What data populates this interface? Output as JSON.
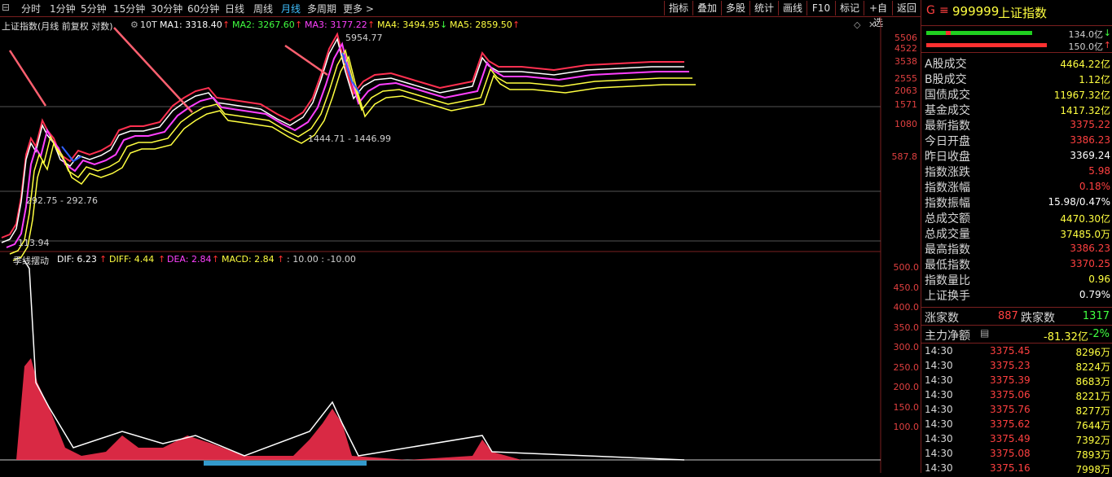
{
  "toolbar": {
    "left_items": [
      "分时",
      "1分钟",
      "5分钟",
      "15分钟",
      "30分钟",
      "60分钟",
      "日线",
      "周线",
      "月线",
      "多周期",
      "更多 >"
    ],
    "active": "月线",
    "right_items": [
      "指标",
      "叠加",
      "多股",
      "统计",
      "画线",
      "F10",
      "标记",
      "+自选",
      "返回"
    ]
  },
  "main_legend": {
    "title": "上证指数(月线 前复权 对数)",
    "period": "10T",
    "ma1": "MA1: 3318.40",
    "ma2": "MA2: 3267.60",
    "ma3": "MA3: 3177.22",
    "ma4": "MA4: 3494.95",
    "ma5": "MA5: 2859.50"
  },
  "main_axis": [
    "5506",
    "4522",
    "3538",
    "2555",
    "2063",
    "1571",
    "1080",
    "587.8"
  ],
  "annotations": {
    "high": "5954.77",
    "mid_low": "1444.71 - 1446.99",
    "early_low": "292.75 - 292.76",
    "start_low": "113.94"
  },
  "sub_legend": {
    "title": "季线摆动",
    "dif": "DIF: 6.23",
    "diff": "DIFF: 4.44",
    "dea": "DEA: 2.84",
    "macd": "MACD: 2.84",
    "extra": ": 10.00  : -10.00"
  },
  "sub_axis": [
    "500.0",
    "450.0",
    "400.0",
    "350.0",
    "300.0",
    "250.0",
    "200.0",
    "150.0",
    "100.0"
  ],
  "colors": {
    "ma1": "#ffffff",
    "ma2": "#40ff40",
    "ma3": "#ff40ff",
    "ma4": "#ffff40",
    "ma5": "#ffff40",
    "up": "#ff3050",
    "down": "#3060ff",
    "frame": "#7a1f1f"
  },
  "right_panel": {
    "header_code": "999999",
    "header_name": "上证指数",
    "header_prefix": "G",
    "bar1_value": "134.0亿",
    "bar2_value": "150.0亿",
    "stats": [
      {
        "label": "A股成交",
        "value": "4464.22亿",
        "color": "yellow"
      },
      {
        "label": "B股成交",
        "value": "1.12亿",
        "color": "yellow"
      },
      {
        "label": "国债成交",
        "value": "11967.32亿",
        "color": "yellow"
      },
      {
        "label": "基金成交",
        "value": "1417.32亿",
        "color": "yellow"
      },
      {
        "label": "最新指数",
        "value": "3375.22",
        "color": "red"
      },
      {
        "label": "今日开盘",
        "value": "3386.23",
        "color": "red"
      },
      {
        "label": "昨日收盘",
        "value": "3369.24",
        "color": "white"
      },
      {
        "label": "指数涨跌",
        "value": "5.98",
        "color": "red"
      },
      {
        "label": "指数涨幅",
        "value": "0.18%",
        "color": "red"
      },
      {
        "label": "指数振幅",
        "value": "15.98/0.47%",
        "color": "white"
      },
      {
        "label": "总成交额",
        "value": "4470.30亿",
        "color": "yellow"
      },
      {
        "label": "总成交量",
        "value": "37485.0万",
        "color": "yellow"
      },
      {
        "label": "最高指数",
        "value": "3386.23",
        "color": "red"
      },
      {
        "label": "最低指数",
        "value": "3370.25",
        "color": "red"
      },
      {
        "label": "指数量比",
        "value": "0.96",
        "color": "yellow"
      },
      {
        "label": "上证换手",
        "value": "0.79%",
        "color": "white"
      }
    ],
    "rise_label": "涨家数",
    "rise_value": "887",
    "fall_label": "跌家数",
    "fall_value": "1317",
    "netflow_label": "主力净额",
    "netflow_value": "-81.32亿",
    "netflow_pct": "-2%",
    "ticks": [
      {
        "time": "14:30",
        "price": "3375.45",
        "vol": "8296万"
      },
      {
        "time": "14:30",
        "price": "3375.23",
        "vol": "8224万"
      },
      {
        "time": "14:30",
        "price": "3375.39",
        "vol": "8683万"
      },
      {
        "time": "14:30",
        "price": "3375.06",
        "vol": "8221万"
      },
      {
        "time": "14:30",
        "price": "3375.76",
        "vol": "8277万"
      },
      {
        "time": "14:30",
        "price": "3375.62",
        "vol": "7644万"
      },
      {
        "time": "14:30",
        "price": "3375.49",
        "vol": "7392万"
      },
      {
        "time": "14:30",
        "price": "3375.08",
        "vol": "7893万"
      },
      {
        "time": "14:30",
        "price": "3375.16",
        "vol": "7998万"
      }
    ]
  }
}
